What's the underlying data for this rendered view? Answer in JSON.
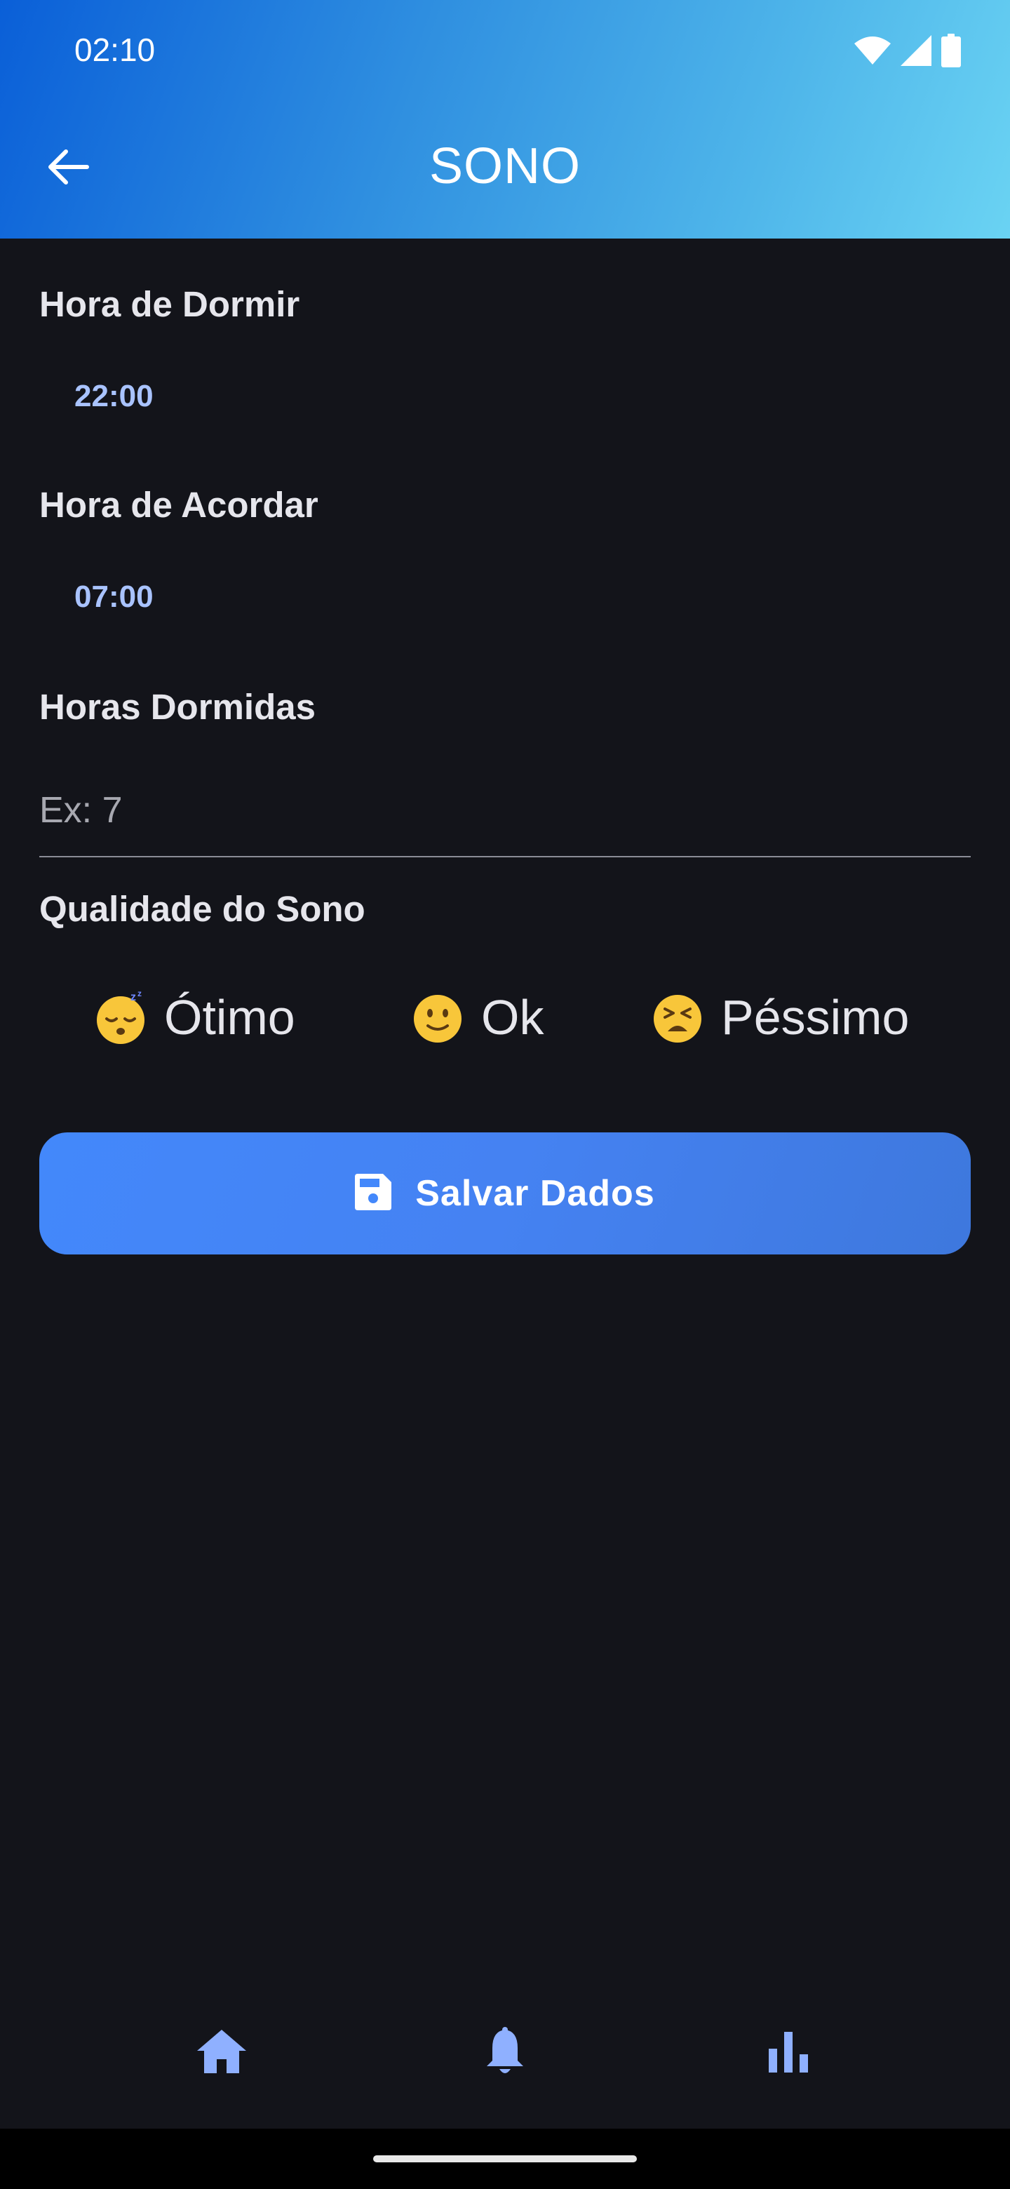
{
  "status_bar": {
    "time": "02:10",
    "icons": [
      "wifi-icon",
      "cellular-signal-icon",
      "battery-icon"
    ]
  },
  "app_bar": {
    "title": "SONO",
    "back_icon": "arrow-left-icon"
  },
  "form": {
    "bedtime": {
      "label": "Hora de Dormir",
      "value": "22:00"
    },
    "wake_time": {
      "label": "Hora de Acordar",
      "value": "07:00"
    },
    "hours_slept": {
      "label": "Horas Dormidas",
      "value": "",
      "placeholder": "Ex: 7"
    },
    "quality": {
      "label": "Qualidade do Sono",
      "options": [
        {
          "label": "Ótimo",
          "icon": "sleeping-face-emoji"
        },
        {
          "label": "Ok",
          "icon": "slightly-smiling-face-emoji"
        },
        {
          "label": "Péssimo",
          "icon": "tired-face-emoji"
        }
      ]
    }
  },
  "save_button": {
    "label": "Salvar Dados",
    "icon": "floppy-disk-icon"
  },
  "bottom_nav": {
    "items": [
      {
        "icon": "home-icon"
      },
      {
        "icon": "bell-icon"
      },
      {
        "icon": "bar-chart-icon"
      }
    ]
  },
  "colors": {
    "background": "#13141a",
    "header_start": "#0a5fd8",
    "header_end": "#6ad3f3",
    "accent": "#a9c3ff",
    "button": "#4388fb",
    "nav_icon": "#8fb0ff"
  }
}
